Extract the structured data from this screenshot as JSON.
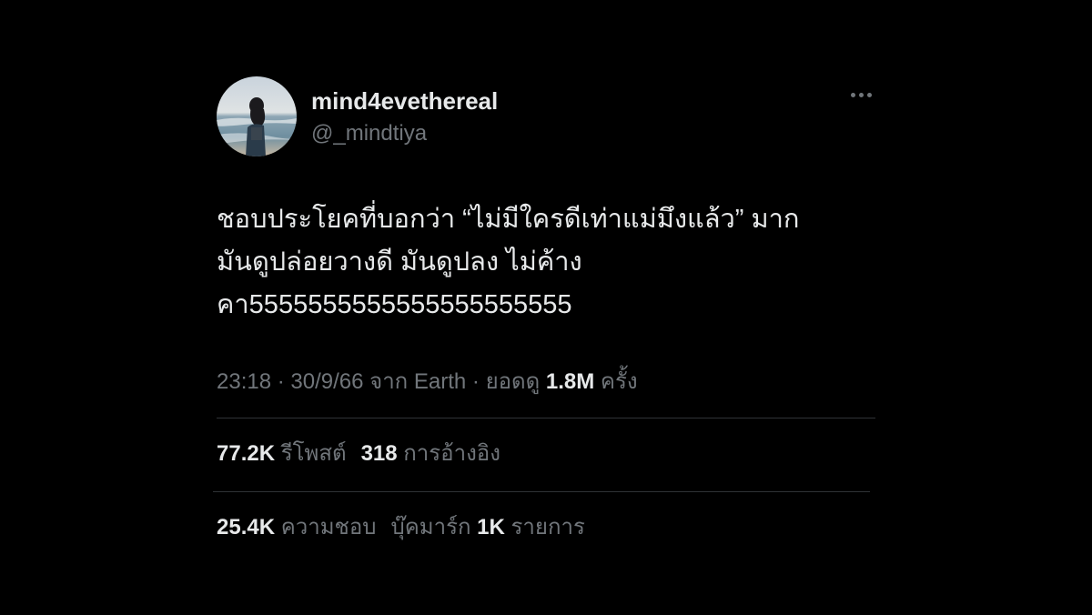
{
  "user": {
    "display_name": "mind4evethereal",
    "handle": "@_mindtiya",
    "avatar_icon": "profile-photo-beach"
  },
  "more_icon": "more-options-icon",
  "tweet": {
    "line1": "ชอบประโยคที่บอกว่า “ไม่มีใครดีเท่าแม่มึงแล้ว” มาก",
    "line2": "มันดูปล่อยวางดี มันดูปลง ไม่ค้าง",
    "line3": "คา5555555555555555555555"
  },
  "meta": {
    "time": "23:18",
    "sep1": " · ",
    "date": "30/9/66",
    "from": " จาก ",
    "source": "Earth",
    "sep2": " · ",
    "views_prefix": "ยอดดู ",
    "views": "1.8M",
    "views_suffix": " ครั้ง"
  },
  "stats_row1": {
    "retweets_count": "77.2K",
    "retweets_label": " รีโพสต์",
    "quotes_count": "318",
    "quotes_label": " การอ้างอิง"
  },
  "stats_row2": {
    "likes_count": "25.4K",
    "likes_label": " ความชอบ",
    "bookmarks_prefix": "บุ๊คมาร์ก ",
    "bookmarks_count": "1K",
    "bookmarks_label": " รายการ"
  },
  "colors": {
    "background": "#000000",
    "primary_text": "#e7e9ea",
    "secondary_text": "#71767b",
    "divider": "#2f3336"
  }
}
